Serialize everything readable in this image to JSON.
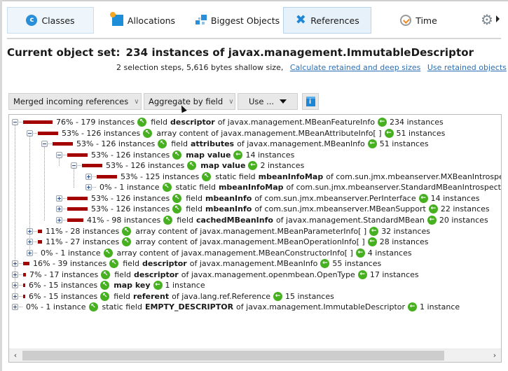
{
  "views": [
    {
      "label": "Classes",
      "icon": "classes-icon",
      "active": false
    },
    {
      "label": "Allocations",
      "icon": "allocations-icon",
      "active": false
    },
    {
      "label": "Biggest Objects",
      "icon": "biggest-objects-icon",
      "active": false
    },
    {
      "label": "References",
      "icon": "references-icon",
      "active": true
    },
    {
      "label": "Time",
      "icon": "time-icon",
      "active": false
    }
  ],
  "header": {
    "title_label": "Current object set:",
    "title_value": "234 instances of javax.management.ImmutableDescriptor",
    "summary": "2 selection steps, 5,616 bytes shallow size,",
    "link_retained": "Calculate retained and deep sizes",
    "link_use_retained": "Use retained objects"
  },
  "toolbar": {
    "reference_mode": "Merged incoming references",
    "aggregation": "Aggregate by field",
    "use_label": "Use ..."
  },
  "icons": {
    "classes_glyph": "c",
    "info_glyph": "i",
    "out_arrow": "↖",
    "in_arrow": "←",
    "gear": "⚙",
    "references": "✖",
    "scroll_left": "‹",
    "scroll_right": "›"
  },
  "colors": {
    "bar": "#a30000",
    "ref_icon": "#46b021",
    "link": "#2c6fb6",
    "active_tab_bg": "#e7f1fa"
  },
  "tree": [
    {
      "level": 0,
      "expanded": true,
      "pct": 76,
      "count": "76% - 179 instances",
      "pre": "field",
      "name": "descriptor",
      "post": "of javax.management.MBeanFeatureInfo",
      "back": "234 instances"
    },
    {
      "level": 1,
      "expanded": true,
      "pct": 53,
      "count": "53% - 126 instances",
      "pre": "array content of javax.management.MBeanAttributeInfo[ ]",
      "name": "",
      "post": "",
      "back": "51 instances"
    },
    {
      "level": 2,
      "expanded": true,
      "pct": 53,
      "count": "53% - 126 instances",
      "pre": "field",
      "name": "attributes",
      "post": "of javax.management.MBeanInfo",
      "back": "51 instances"
    },
    {
      "level": 3,
      "expanded": true,
      "pct": 53,
      "count": "53% - 126 instances",
      "pre": "",
      "name": "map value",
      "post": "",
      "back": "14 instances"
    },
    {
      "level": 4,
      "expanded": true,
      "pct": 53,
      "count": "53% - 126 instances",
      "pre": "",
      "name": "map value",
      "post": "",
      "back": "2 instances"
    },
    {
      "level": 5,
      "expanded": false,
      "pct": 53,
      "count": "53% - 125 instances",
      "pre": "static field",
      "name": "mbeanInfoMap",
      "post": "of com.sun.jmx.mbeanserver.MXBeanIntrospector",
      "back": ""
    },
    {
      "level": 5,
      "expanded": false,
      "pct": 0,
      "count": "0% - 1 instance",
      "pre": "static field",
      "name": "mbeanInfoMap",
      "post": "of com.sun.jmx.mbeanserver.StandardMBeanIntrospector",
      "back": ""
    },
    {
      "level": 3,
      "expanded": false,
      "pct": 53,
      "count": "53% - 126 instances",
      "pre": "field",
      "name": "mbeanInfo",
      "post": "of com.sun.jmx.mbeanserver.PerInterface",
      "back": "14 instances"
    },
    {
      "level": 3,
      "expanded": false,
      "pct": 53,
      "count": "53% - 126 instances",
      "pre": "field",
      "name": "mbeanInfo",
      "post": "of com.sun.jmx.mbeanserver.MBeanSupport",
      "back": "22 instances"
    },
    {
      "level": 3,
      "expanded": false,
      "pct": 41,
      "count": "41% - 98 instances",
      "pre": "field",
      "name": "cachedMBeanInfo",
      "post": "of javax.management.StandardMBean",
      "back": "20 instances"
    },
    {
      "level": 1,
      "expanded": false,
      "pct": 11,
      "count": "11% - 28 instances",
      "pre": "array content of javax.management.MBeanParameterInfo[ ]",
      "name": "",
      "post": "",
      "back": "32 instances"
    },
    {
      "level": 1,
      "expanded": false,
      "pct": 11,
      "count": "11% - 27 instances",
      "pre": "array content of javax.management.MBeanOperationInfo[ ]",
      "name": "",
      "post": "",
      "back": "28 instances"
    },
    {
      "level": 1,
      "expanded": false,
      "pct": 0,
      "count": "0% - 1 instance",
      "pre": "array content of javax.management.MBeanConstructorInfo[ ]",
      "name": "",
      "post": "",
      "back": "4 instances"
    },
    {
      "level": 0,
      "expanded": false,
      "pct": 16,
      "count": "16% - 39 instances",
      "pre": "field",
      "name": "descriptor",
      "post": "of javax.management.MBeanInfo",
      "back": "55 instances"
    },
    {
      "level": 0,
      "expanded": false,
      "pct": 7,
      "count": "7% - 17 instances",
      "pre": "field",
      "name": "descriptor",
      "post": "of javax.management.openmbean.OpenType",
      "back": "17 instances"
    },
    {
      "level": 0,
      "expanded": false,
      "pct": 6,
      "count": "6% - 15 instances",
      "pre": "",
      "name": "map key",
      "post": "",
      "back": "1 instance"
    },
    {
      "level": 0,
      "expanded": false,
      "pct": 6,
      "count": "6% - 15 instances",
      "pre": "field",
      "name": "referent",
      "post": "of java.lang.ref.Reference",
      "back": "15 instances"
    },
    {
      "level": 0,
      "expanded": false,
      "pct": 0,
      "count": "0% - 1 instance",
      "pre": "static field",
      "name": "EMPTY_DESCRIPTOR",
      "post": "of javax.management.ImmutableDescriptor",
      "back": "1 instance"
    }
  ]
}
